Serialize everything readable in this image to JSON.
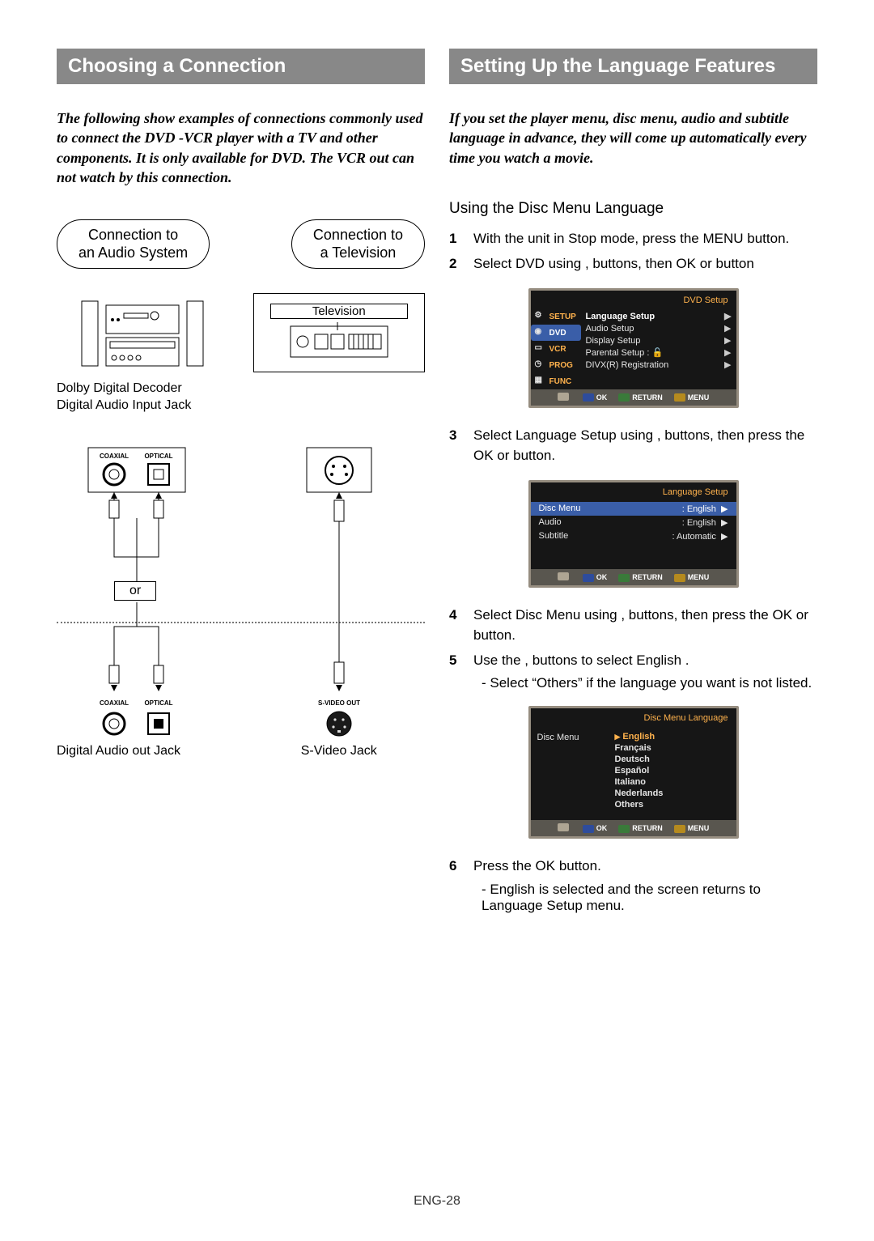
{
  "left": {
    "title": "Choosing a Connection",
    "intro": "The following show examples of connections commonly used to connect the DVD -VCR player with a TV and other components. It is only available for DVD. The VCR out can not watch by this connection.",
    "pill_audio_l1": "Connection to",
    "pill_audio_l2": "an Audio System",
    "pill_tv_l1": "Connection to",
    "pill_tv_l2": "a Television",
    "tv_label": "Television",
    "dolby_l1": "Dolby Digital Decoder",
    "dolby_l2": "Digital Audio Input Jack",
    "coaxial": "COAXIAL",
    "optical": "OPTICAL",
    "svideoout": "S-VIDEO OUT",
    "or": "or",
    "bottom_left": "Digital Audio out Jack",
    "bottom_right": "S-Video Jack"
  },
  "right": {
    "title": "Setting Up the Language Features",
    "intro": "If you set the player menu, disc menu, audio and subtitle language in advance, they will come up automatically every time you watch a movie.",
    "sub": "Using the Disc Menu Language",
    "step1": "With the unit in Stop mode, press the MENU button.",
    "step2": "Select DVD using     ,     buttons, then OK or      button",
    "step3": "Select Language Setup  using      ,      buttons, then press the OK or      button.",
    "step4": "Select Disc Menu  using      ,      buttons, then press the OK or      button.",
    "step5a": "Use the     ,      buttons to select English .",
    "step5b": "- Select “Others” if the language you want is not listed.",
    "step6a": "Press the OK button.",
    "step6b": "- English is selected and the screen returns to Language Setup  menu.",
    "osd1": {
      "title": "DVD Setup",
      "side": {
        "setup": "SETUP",
        "dvd": "DVD",
        "vcr": "VCR",
        "prog": "PROG",
        "func": "FUNC"
      },
      "rows": [
        "Language Setup",
        "Audio Setup",
        "Display Setup",
        "Parental Setup      :",
        "DIVX(R) Registration"
      ],
      "foot_ok": "OK",
      "foot_return": "RETURN",
      "foot_menu": "MENU"
    },
    "osd2": {
      "title": "Language Setup",
      "rows": [
        {
          "k": "Disc Menu",
          "v": ": English"
        },
        {
          "k": "Audio",
          "v": ": English"
        },
        {
          "k": "Subtitle",
          "v": ": Automatic"
        }
      ],
      "foot_ok": "OK",
      "foot_return": "RETURN",
      "foot_menu": "MENU"
    },
    "osd3": {
      "title": "Disc Menu Language",
      "left": "Disc Menu",
      "langs": [
        "English",
        "Français",
        "Deutsch",
        "Español",
        "Italiano",
        "Nederlands",
        "Others"
      ],
      "foot_ok": "OK",
      "foot_return": "RETURN",
      "foot_menu": "MENU"
    }
  },
  "page_no": "ENG-28"
}
